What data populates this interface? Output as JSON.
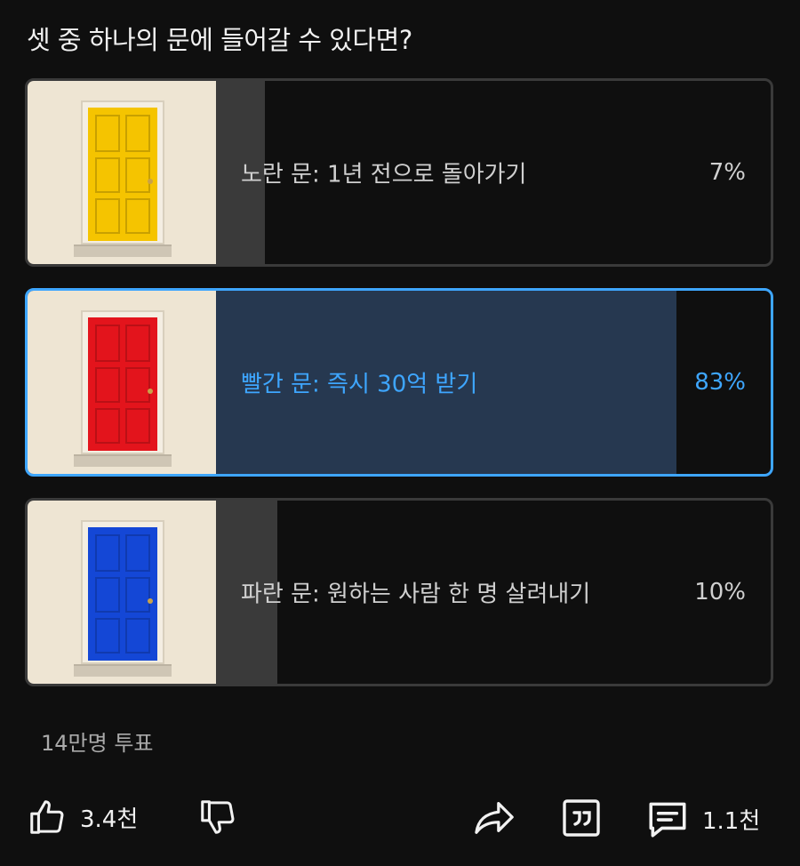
{
  "poll": {
    "question": "셋 중 하나의 문에 들어갈 수 있다면?",
    "options": [
      {
        "label": "노란 문: 1년 전으로 돌아가기",
        "percent_label": "7%",
        "percent": 7,
        "door_color": "#f5c400",
        "selected": false
      },
      {
        "label": "빨간 문: 즉시 30억 받기",
        "percent_label": "83%",
        "percent": 83,
        "door_color": "#e3141c",
        "selected": true
      },
      {
        "label": "파란 문: 원하는 사람 한 명 살려내기",
        "percent_label": "10%",
        "percent": 10,
        "door_color": "#1447d6",
        "selected": false
      }
    ],
    "vote_count": "14만명 투표"
  },
  "actions": {
    "like_count": "3.4천",
    "comment_count": "1.1천",
    "icons": [
      "thumbs-up-icon",
      "thumbs-down-icon",
      "share-icon",
      "quote-icon",
      "comment-icon"
    ]
  },
  "colors": {
    "accent": "#3ea6ff",
    "selected_fill": "#263850",
    "fill": "#3a3a3a",
    "background": "#0f0f0f"
  }
}
